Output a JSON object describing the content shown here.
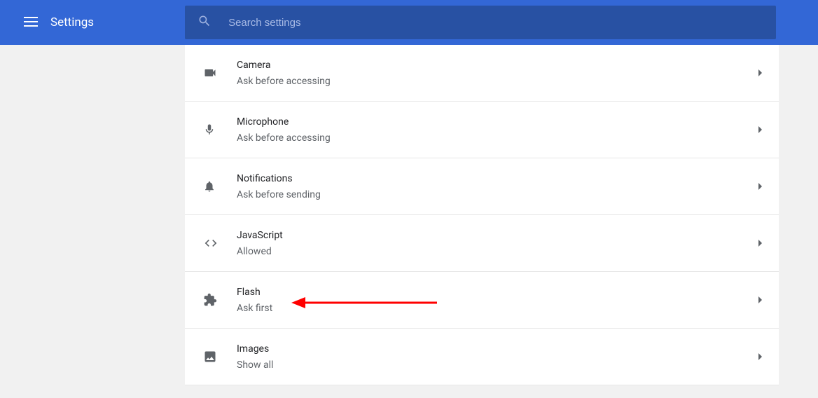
{
  "header": {
    "title": "Settings",
    "search_placeholder": "Search settings"
  },
  "rows": [
    {
      "icon": "camera-icon",
      "title": "Camera",
      "sub": "Ask before accessing"
    },
    {
      "icon": "microphone-icon",
      "title": "Microphone",
      "sub": "Ask before accessing"
    },
    {
      "icon": "notifications-icon",
      "title": "Notifications",
      "sub": "Ask before sending"
    },
    {
      "icon": "javascript-icon",
      "title": "JavaScript",
      "sub": "Allowed"
    },
    {
      "icon": "flash-icon",
      "title": "Flash",
      "sub": "Ask first"
    },
    {
      "icon": "images-icon",
      "title": "Images",
      "sub": "Show all"
    }
  ]
}
